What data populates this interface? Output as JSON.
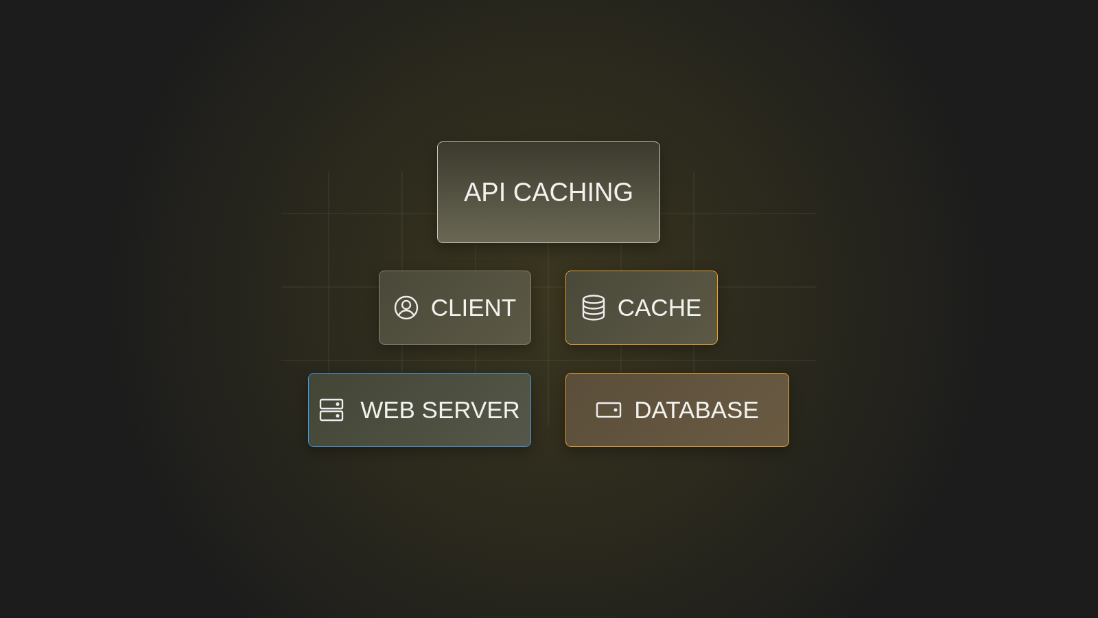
{
  "diagram": {
    "nodes": [
      {
        "label": "API CACHING",
        "kind": "title",
        "color": "#c9c6b8"
      },
      {
        "label": "CLIENT",
        "kind": "client",
        "color": "#8a8672"
      },
      {
        "label": "CACHE",
        "kind": "cache",
        "color": "#f0a52a"
      },
      {
        "label": "WEB SERVER",
        "kind": "server",
        "color": "#3a9be8"
      },
      {
        "label": "DATABASE",
        "kind": "database",
        "color": "#f0a52a"
      }
    ]
  }
}
